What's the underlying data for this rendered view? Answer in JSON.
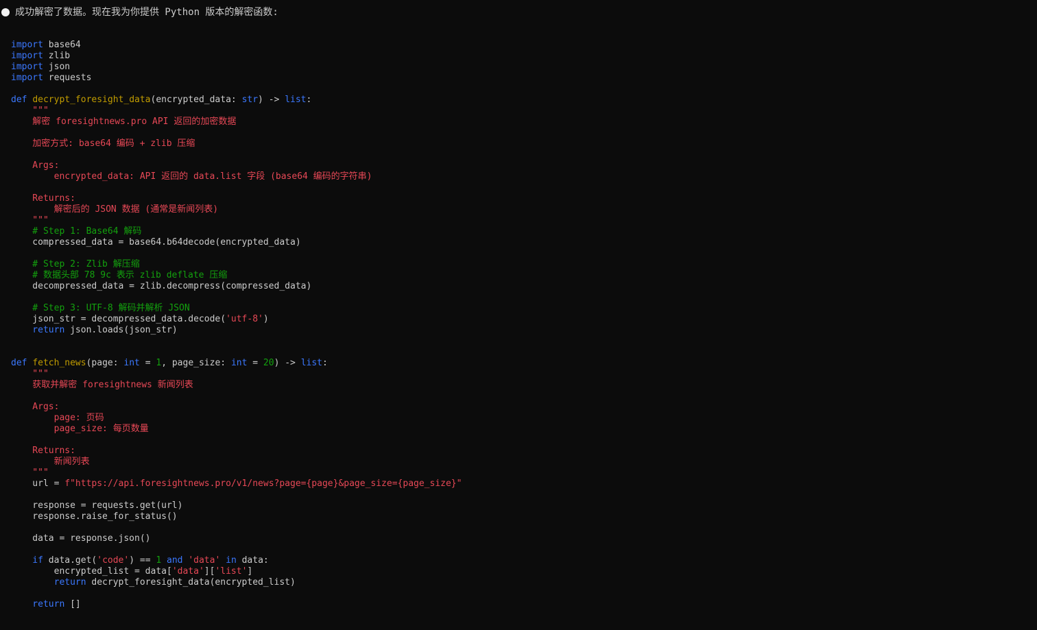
{
  "message": {
    "text": "成功解密了数据。现在我为你提供 Python 版本的解密函数:"
  },
  "colors": {
    "background": "#0c0c0c",
    "text": "#cccccc",
    "keyword": "#3b78ff",
    "function": "#c19c00",
    "string": "#e74856",
    "number_comment": "#13a10e"
  },
  "code_lines": [
    [
      [
        "kw",
        "import"
      ],
      [
        "tx",
        " base64"
      ]
    ],
    [
      [
        "kw",
        "import"
      ],
      [
        "tx",
        " zlib"
      ]
    ],
    [
      [
        "kw",
        "import"
      ],
      [
        "tx",
        " json"
      ]
    ],
    [
      [
        "kw",
        "import"
      ],
      [
        "tx",
        " requests"
      ]
    ],
    [],
    [
      [
        "kw",
        "def"
      ],
      [
        "tx",
        " "
      ],
      [
        "fn",
        "decrypt_foresight_data"
      ],
      [
        "tx",
        "(encrypted_data: "
      ],
      [
        "kw",
        "str"
      ],
      [
        "tx",
        ") -> "
      ],
      [
        "kw",
        "list"
      ],
      [
        "tx",
        ":"
      ]
    ],
    [
      [
        "str",
        "    \"\"\""
      ]
    ],
    [
      [
        "str",
        "    解密 foresightnews.pro API 返回的加密数据"
      ]
    ],
    [],
    [
      [
        "str",
        "    加密方式: base64 编码 + zlib 压缩"
      ]
    ],
    [],
    [
      [
        "str",
        "    Args:"
      ]
    ],
    [
      [
        "str",
        "        encrypted_data: API 返回的 data.list 字段 (base64 编码的字符串)"
      ]
    ],
    [],
    [
      [
        "str",
        "    Returns:"
      ]
    ],
    [
      [
        "str",
        "        解密后的 JSON 数据 (通常是新闻列表)"
      ]
    ],
    [
      [
        "str",
        "    \"\"\""
      ]
    ],
    [
      [
        "cm",
        "    # Step 1: Base64 解码"
      ]
    ],
    [
      [
        "tx",
        "    compressed_data = base64.b64decode(encrypted_data)"
      ]
    ],
    [],
    [
      [
        "cm",
        "    # Step 2: Zlib 解压缩"
      ]
    ],
    [
      [
        "cm",
        "    # 数据头部 78 9c 表示 zlib deflate 压缩"
      ]
    ],
    [
      [
        "tx",
        "    decompressed_data = zlib.decompress(compressed_data)"
      ]
    ],
    [],
    [
      [
        "cm",
        "    # Step 3: UTF-8 解码并解析 JSON"
      ]
    ],
    [
      [
        "tx",
        "    json_str = decompressed_data.decode("
      ],
      [
        "str",
        "'utf-8'"
      ],
      [
        "tx",
        ")"
      ]
    ],
    [
      [
        "kw",
        "    return"
      ],
      [
        "tx",
        " json.loads(json_str)"
      ]
    ],
    [],
    [],
    [
      [
        "kw",
        "def"
      ],
      [
        "tx",
        " "
      ],
      [
        "fn",
        "fetch_news"
      ],
      [
        "tx",
        "(page: "
      ],
      [
        "kw",
        "int"
      ],
      [
        "tx",
        " = "
      ],
      [
        "num",
        "1"
      ],
      [
        "tx",
        ", page_size: "
      ],
      [
        "kw",
        "int"
      ],
      [
        "tx",
        " = "
      ],
      [
        "num",
        "20"
      ],
      [
        "tx",
        ") -> "
      ],
      [
        "kw",
        "list"
      ],
      [
        "tx",
        ":"
      ]
    ],
    [
      [
        "str",
        "    \"\"\""
      ]
    ],
    [
      [
        "str",
        "    获取并解密 foresightnews 新闻列表"
      ]
    ],
    [],
    [
      [
        "str",
        "    Args:"
      ]
    ],
    [
      [
        "str",
        "        page: 页码"
      ]
    ],
    [
      [
        "str",
        "        page_size: 每页数量"
      ]
    ],
    [],
    [
      [
        "str",
        "    Returns:"
      ]
    ],
    [
      [
        "str",
        "        新闻列表"
      ]
    ],
    [
      [
        "str",
        "    \"\"\""
      ]
    ],
    [
      [
        "tx",
        "    url = "
      ],
      [
        "str",
        "f\"https://api.foresightnews.pro/v1/news?page={page}&page_size={page_size}\""
      ]
    ],
    [],
    [
      [
        "tx",
        "    response = requests.get(url)"
      ]
    ],
    [
      [
        "tx",
        "    response.raise_for_status()"
      ]
    ],
    [],
    [
      [
        "tx",
        "    data = response.json()"
      ]
    ],
    [],
    [
      [
        "kw",
        "    if"
      ],
      [
        "tx",
        " data.get("
      ],
      [
        "str",
        "'code'"
      ],
      [
        "tx",
        ") == "
      ],
      [
        "num",
        "1"
      ],
      [
        "tx",
        " "
      ],
      [
        "kw",
        "and"
      ],
      [
        "tx",
        " "
      ],
      [
        "str",
        "'data'"
      ],
      [
        "tx",
        " "
      ],
      [
        "kw",
        "in"
      ],
      [
        "tx",
        " data:"
      ]
    ],
    [
      [
        "tx",
        "        encrypted_list = data["
      ],
      [
        "str",
        "'data'"
      ],
      [
        "tx",
        "]["
      ],
      [
        "str",
        "'list'"
      ],
      [
        "tx",
        "]"
      ]
    ],
    [
      [
        "kw",
        "        return"
      ],
      [
        "tx",
        " decrypt_foresight_data(encrypted_list)"
      ]
    ],
    [],
    [
      [
        "kw",
        "    return"
      ],
      [
        "tx",
        " []"
      ]
    ]
  ]
}
